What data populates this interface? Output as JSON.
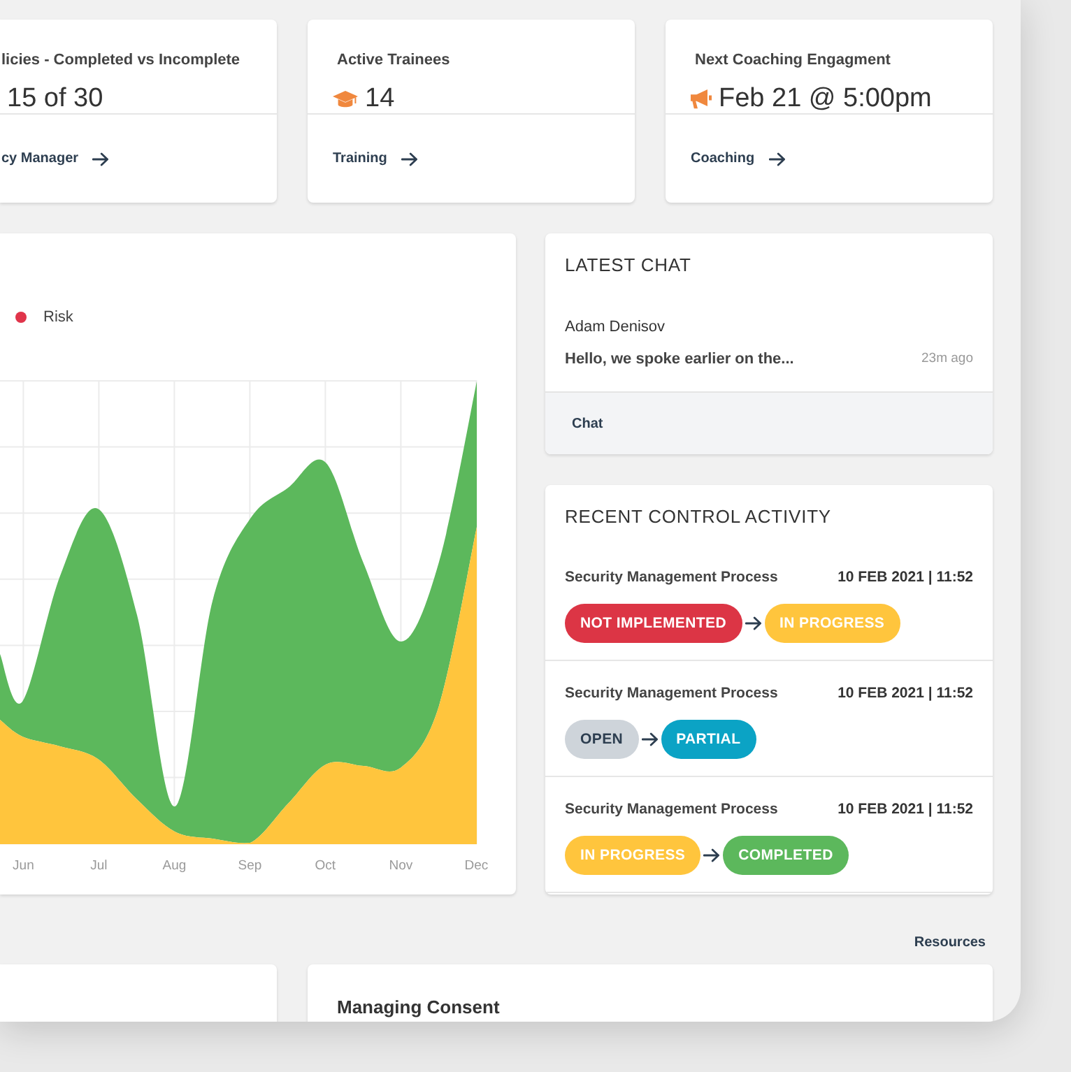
{
  "summary_cards": [
    {
      "title": "licies - Completed vs Incomplete",
      "value": "15 of 30",
      "link": "cy Manager"
    },
    {
      "title": "Active Trainees",
      "value": "14",
      "link": "Training"
    },
    {
      "title": "Next Coaching Engagment",
      "value": "Feb 21 @ 5:00pm",
      "link": "Coaching"
    }
  ],
  "chart": {
    "legend": [
      {
        "label": "Risk",
        "color": "#e0344a"
      }
    ],
    "x_labels": [
      "Jun",
      "Jul",
      "Aug",
      "Sep",
      "Oct",
      "Nov",
      "Dec"
    ]
  },
  "latest_chat": {
    "title": "LATEST CHAT",
    "sender": "Adam Denisov",
    "message": "Hello, we spoke earlier on the...",
    "time": "23m ago",
    "link": "Chat"
  },
  "recent_control_activity": {
    "title": "RECENT CONTROL ACTIVITY",
    "items": [
      {
        "name": "Security Management Process",
        "date": "10 FEB 2021 | 11:52",
        "from": {
          "label": "NOT IMPLEMENTED",
          "color": "#dc3545"
        },
        "to": {
          "label": "IN PROGRESS",
          "color": "#ffc53d"
        }
      },
      {
        "name": "Security Management Process",
        "date": "10 FEB 2021 | 11:52",
        "from": {
          "label": "OPEN",
          "color": "#ced4da"
        },
        "to": {
          "label": "PARTIAL",
          "color": "#0ba3c5"
        }
      },
      {
        "name": "Security Management Process",
        "date": "10 FEB 2021 | 11:52",
        "from": {
          "label": "IN PROGRESS",
          "color": "#ffc53d"
        },
        "to": {
          "label": "COMPLETED",
          "color": "#5cb85c"
        }
      }
    ]
  },
  "resources": {
    "link": "Resources",
    "cards": [
      {
        "title": "Managing Consent"
      }
    ]
  }
}
